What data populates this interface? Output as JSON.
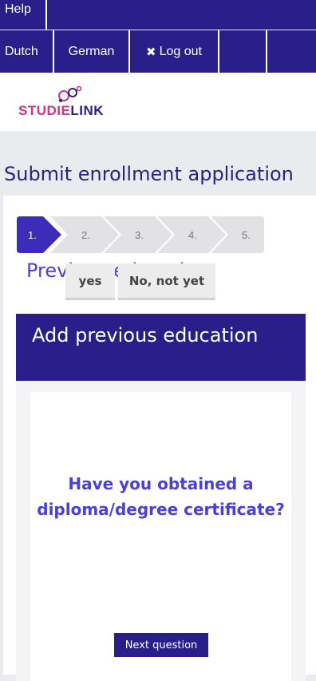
{
  "nav": {
    "help": "Help",
    "languages": [
      "Dutch",
      "German"
    ],
    "logout": "Log out"
  },
  "logo": {
    "text_part1": "STUDIE",
    "text_part2": "LINK",
    "colors": {
      "pink": "#d6337f",
      "navy": "#2a1f8a"
    }
  },
  "page_title": "Submit enrollment application",
  "steps": {
    "items": [
      "1.",
      "2.",
      "3.",
      "4.",
      "5."
    ],
    "active_index": 0,
    "current_label": "Previous education"
  },
  "card": {
    "title": "Add previous education",
    "question": "Have you obtained a diploma/degree certificate?",
    "answers": {
      "yes": "yes",
      "no": "No, not yet"
    },
    "next_button": "Next question"
  },
  "colors": {
    "primary": "#2a1f8a",
    "accent": "#4a3fd8",
    "background": "#e9ebee"
  }
}
